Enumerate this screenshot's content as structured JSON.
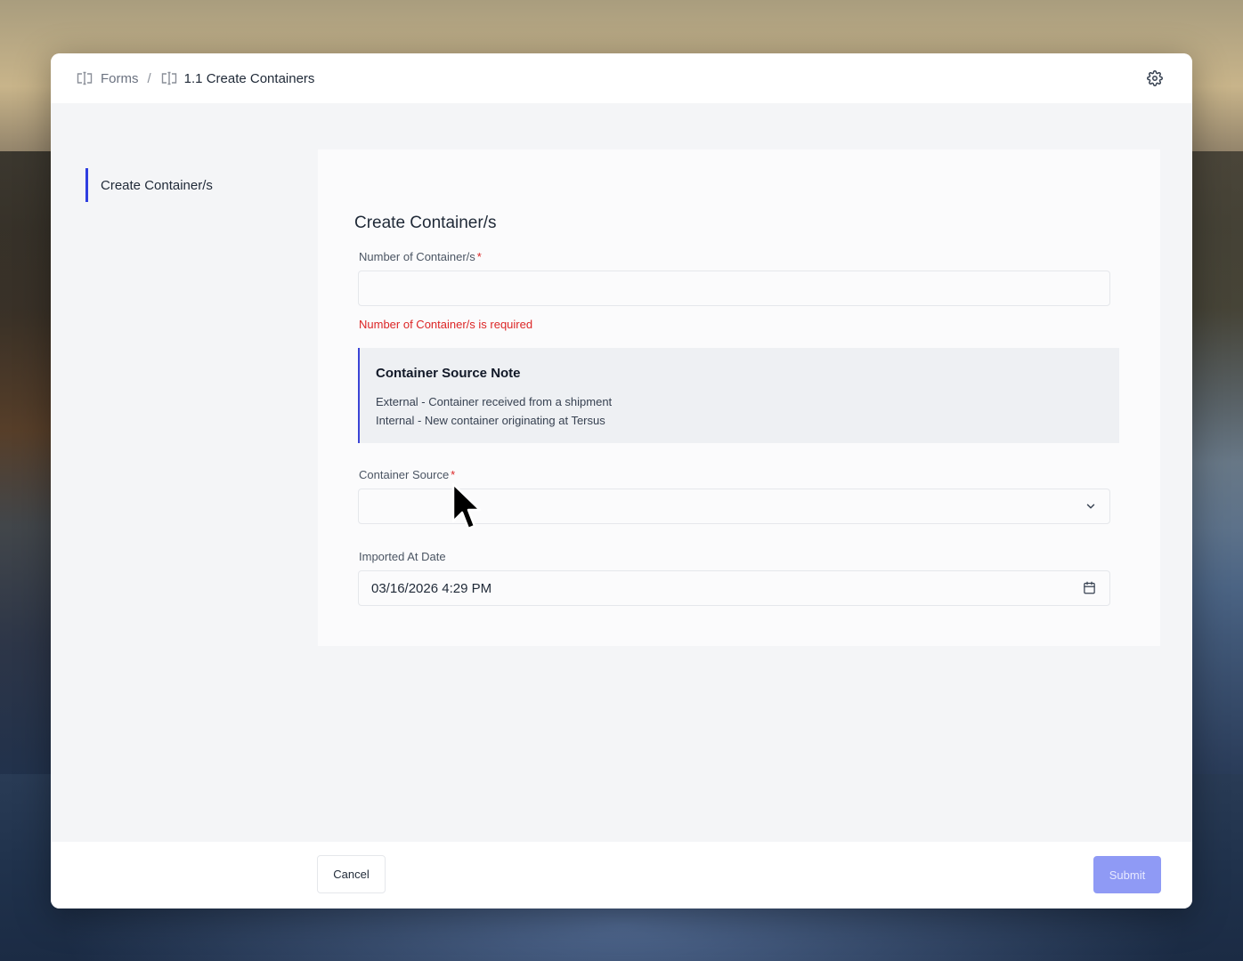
{
  "breadcrumb": {
    "root_label": "Forms",
    "separator": "/",
    "current_label": "1.1 Create Containers"
  },
  "sidebar": {
    "items": [
      {
        "label": "Create Container/s",
        "active": true
      }
    ]
  },
  "form": {
    "title": "Create Container/s",
    "number_of_containers": {
      "label": "Number of Container/s",
      "required_mark": "*",
      "value": "",
      "error": "Number of Container/s is required"
    },
    "note": {
      "title": "Container Source Note",
      "line1": "External - Container received from a shipment",
      "line2": "Internal - New container originating at Tersus"
    },
    "container_source": {
      "label": "Container Source",
      "required_mark": "*",
      "selected": ""
    },
    "imported_at_date": {
      "label": "Imported At Date",
      "value": "03/16/2026 4:29 PM"
    }
  },
  "footer": {
    "cancel_label": "Cancel",
    "submit_label": "Submit"
  },
  "colors": {
    "accent": "#2f3ee0",
    "error": "#dc2626",
    "submit_disabled": "#8f9af5"
  },
  "icons": [
    "form-icon",
    "settings-gear-icon",
    "chevron-down-icon",
    "calendar-icon",
    "mouse-cursor-icon"
  ]
}
